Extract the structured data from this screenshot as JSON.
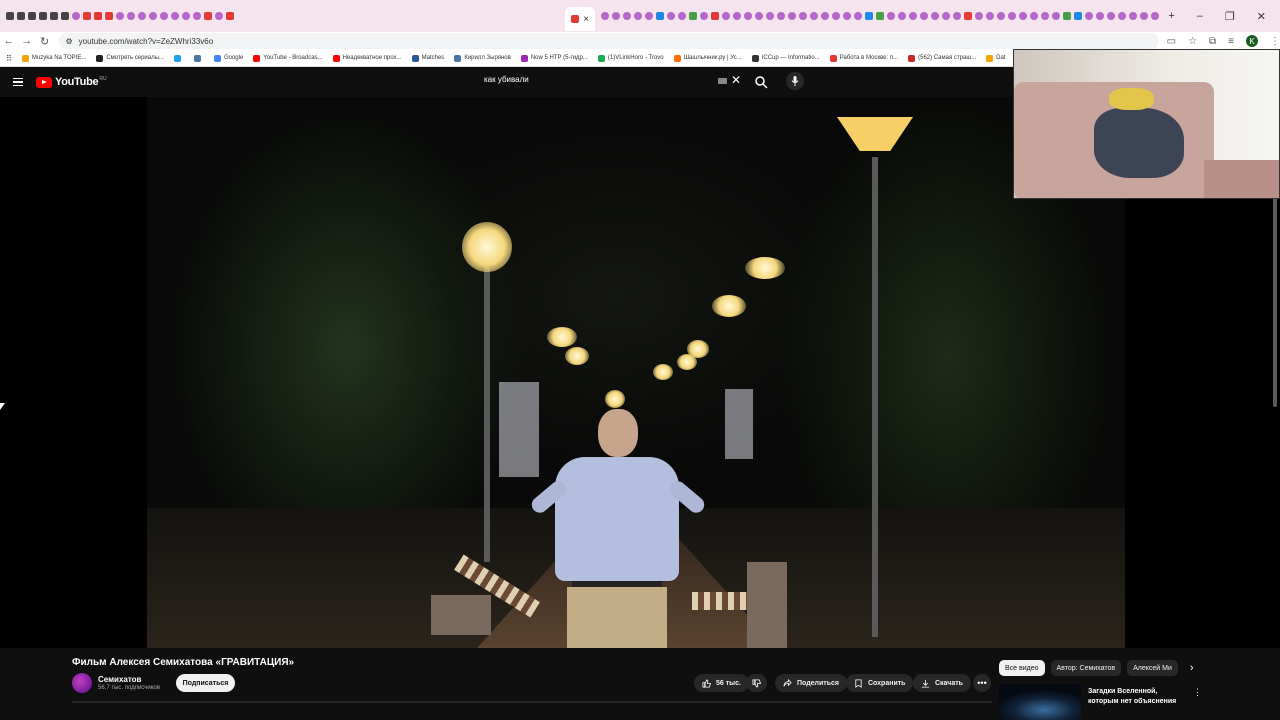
{
  "browser": {
    "active_tab_close": "×",
    "new_tab": "+",
    "url": "youtube.com/watch?v=ZeZWhri33v6o",
    "bookmarks": [
      "Muzyka Na TOPIE...",
      "Смотреть сериалы...",
      "",
      "",
      "Google",
      "YouTube - Broadcas...",
      "Неадекватное прох...",
      "Matches",
      "Кирилл Зырянов",
      "Now 5 НТР (5-гидр...",
      "(1)VLinkHoro - Trovo",
      "Шашлычник.ру | Ус...",
      "ICCup — Informatio...",
      "Работа в Москве: п...",
      "(562) Самая страш...",
      "Dat"
    ],
    "profile_initial": "K"
  },
  "youtube": {
    "logo_text": "YouTube",
    "logo_region": "RU",
    "search_query": "как убивали"
  },
  "video": {
    "title": "Фильм Алексея Семихатова «ГРАВИТАЦИЯ»",
    "channel": "Семихатов",
    "subscribers": "56,7 тыс. подписчиков",
    "subscribe_label": "Подписаться",
    "like_count": "56 тыс.",
    "share_label": "Поделиться",
    "save_label": "Сохранить",
    "download_label": "Скачать",
    "more_label": "•••"
  },
  "recommendations": {
    "chips": [
      "Все видео",
      "Автор: Семихатов",
      "Алексей Ми"
    ],
    "first_title": "Загадки Вселенной, которым нет объяснения"
  },
  "colors": {
    "yt_red": "#ff0000",
    "dark_bg": "#0f0f0f",
    "tab_strip": "#f5e4ee"
  }
}
